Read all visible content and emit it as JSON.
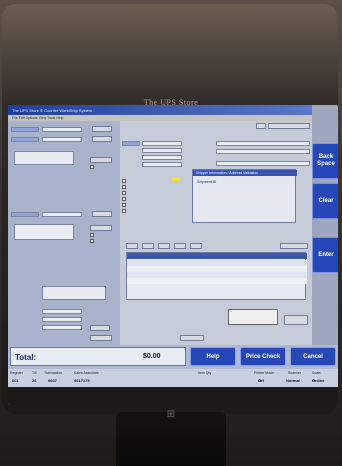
{
  "monitor": {
    "brand": "The UPS Store"
  },
  "window": {
    "title": "The UPS Store ® Counter WorldShip System",
    "menu": "File   Edit   Options   View   Tools   Help"
  },
  "shipper": {
    "header": "Shipper Information / Address Validation",
    "field_label": "Shipment ID"
  },
  "side_buttons": {
    "back_space": "Back Space",
    "clear": "Clear",
    "enter": "Enter"
  },
  "bottom": {
    "total_label": "Total:",
    "total_amount": "$0.00",
    "help": "Help",
    "price_check": "Price Check",
    "cancel": "Cancel"
  },
  "status": {
    "labels": [
      "Register",
      "Till",
      "Transaction",
      "Sales Associate",
      "Item Qty",
      "Printer Mode",
      "Scanner",
      "Scale"
    ],
    "values": [
      "001",
      "26",
      "0607",
      "0617175",
      "",
      "Off",
      "Normal",
      "Online"
    ]
  }
}
